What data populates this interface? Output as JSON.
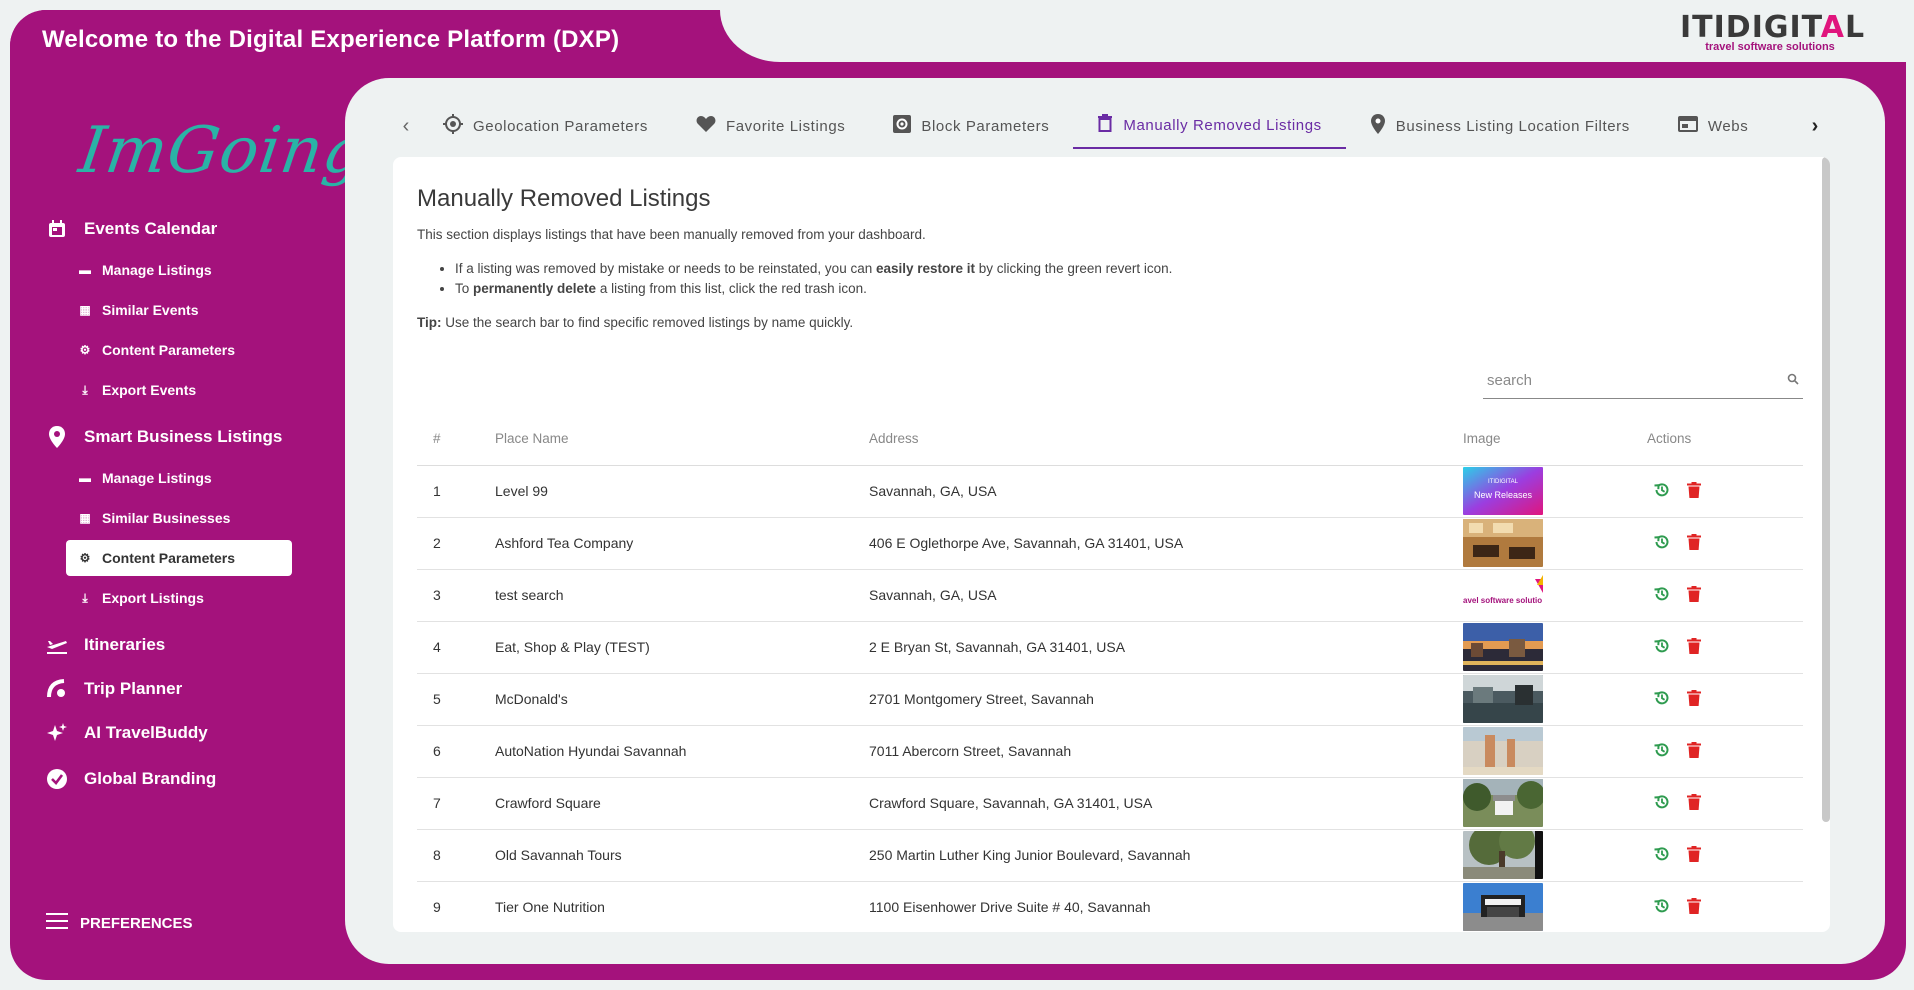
{
  "header": {
    "title": "Welcome to the Digital Experience Platform (DXP)"
  },
  "brand": {
    "name_prefix": "ITIDIGIT",
    "name_tri": "A",
    "name_suffix": "L",
    "tagline": "travel software solutions"
  },
  "sidebar": {
    "logo_text": "ImGoing",
    "groups": [
      {
        "label": "Events Calendar",
        "icon": "calendar-icon"
      },
      {
        "label": "Smart Business Listings",
        "icon": "location-pin-icon"
      },
      {
        "label": "Itineraries",
        "icon": "plane-icon"
      },
      {
        "label": "Trip Planner",
        "icon": "planner-icon"
      },
      {
        "label": "AI TravelBuddy",
        "icon": "sparkle-icon"
      },
      {
        "label": "Global Branding",
        "icon": "verified-badge-icon"
      }
    ],
    "events_items": [
      {
        "label": "Manage Listings",
        "icon": "list-icon"
      },
      {
        "label": "Similar Events",
        "icon": "similar-icon"
      },
      {
        "label": "Content Parameters",
        "icon": "gear-icon"
      },
      {
        "label": "Export Events",
        "icon": "download-icon"
      }
    ],
    "business_items": [
      {
        "label": "Manage Listings",
        "icon": "list-icon"
      },
      {
        "label": "Similar Businesses",
        "icon": "similar-icon"
      },
      {
        "label": "Content Parameters",
        "icon": "gear-icon",
        "active": true
      },
      {
        "label": "Export Listings",
        "icon": "download-icon"
      }
    ],
    "preferences_label": "PREFERENCES"
  },
  "tabs": [
    {
      "label": "Geolocation Parameters",
      "icon": "geolocation-icon"
    },
    {
      "label": "Favorite Listings",
      "icon": "heart-icon"
    },
    {
      "label": "Block Parameters",
      "icon": "block-gear-icon"
    },
    {
      "label": "Manually Removed Listings",
      "icon": "trash-icon",
      "active": true
    },
    {
      "label": "Business Listing Location Filters",
      "icon": "location-pin-icon"
    },
    {
      "label": "Webs",
      "icon": "web-icon"
    }
  ],
  "content": {
    "title": "Manually Removed Listings",
    "description": "This section displays listings that have been manually removed from your dashboard.",
    "bullet1_pre": "If a listing was removed by mistake or needs to be reinstated, you can ",
    "bullet1_bold": "easily restore it",
    "bullet1_post": " by clicking the green revert icon.",
    "bullet2_pre": "To ",
    "bullet2_bold": "permanently delete",
    "bullet2_post": " a listing from this list, click the red trash icon.",
    "tip_label": "Tip:",
    "tip_text": " Use the search bar to find specific removed listings by name quickly."
  },
  "search": {
    "placeholder": "search",
    "value": ""
  },
  "table": {
    "headers": {
      "num": "#",
      "name": "Place Name",
      "address": "Address",
      "image": "Image",
      "actions": "Actions"
    },
    "rows": [
      {
        "num": "1",
        "name": "Level 99",
        "address": "Savannah, GA, USA",
        "thumb": "promo"
      },
      {
        "num": "2",
        "name": "Ashford Tea Company",
        "address": "406 E Oglethorpe Ave, Savannah, GA 31401, USA",
        "thumb": "interior"
      },
      {
        "num": "3",
        "name": "test search",
        "address": "Savannah, GA, USA",
        "thumb": "logo"
      },
      {
        "num": "4",
        "name": "Eat, Shop & Play (TEST)",
        "address": "2 E Bryan St, Savannah, GA 31401, USA",
        "thumb": "dusk"
      },
      {
        "num": "5",
        "name": "McDonald's",
        "address": "2701 Montgomery Street, Savannah",
        "thumb": "harbor"
      },
      {
        "num": "6",
        "name": "AutoNation Hyundai Savannah",
        "address": "7011 Abercorn Street, Savannah",
        "thumb": "beach"
      },
      {
        "num": "7",
        "name": "Crawford Square",
        "address": "Crawford Square, Savannah, GA 31401, USA",
        "thumb": "park"
      },
      {
        "num": "8",
        "name": "Old Savannah Tours",
        "address": "250 Martin Luther King Junior Boulevard, Savannah",
        "thumb": "oak"
      },
      {
        "num": "9",
        "name": "Tier One Nutrition",
        "address": "1100 Eisenhower Drive Suite # 40, Savannah",
        "thumb": "store"
      }
    ],
    "thumb_promo_text_top": "ITIDIGITAL",
    "thumb_promo_text": "New Releases",
    "thumb_logo_text": "avel software solutio"
  },
  "colors": {
    "brand_magenta": "#a4127c",
    "tab_active": "#6a2ca4",
    "restore_green": "#2e9b4f",
    "delete_red": "#e02424",
    "logo_teal": "#2ab3a6"
  }
}
